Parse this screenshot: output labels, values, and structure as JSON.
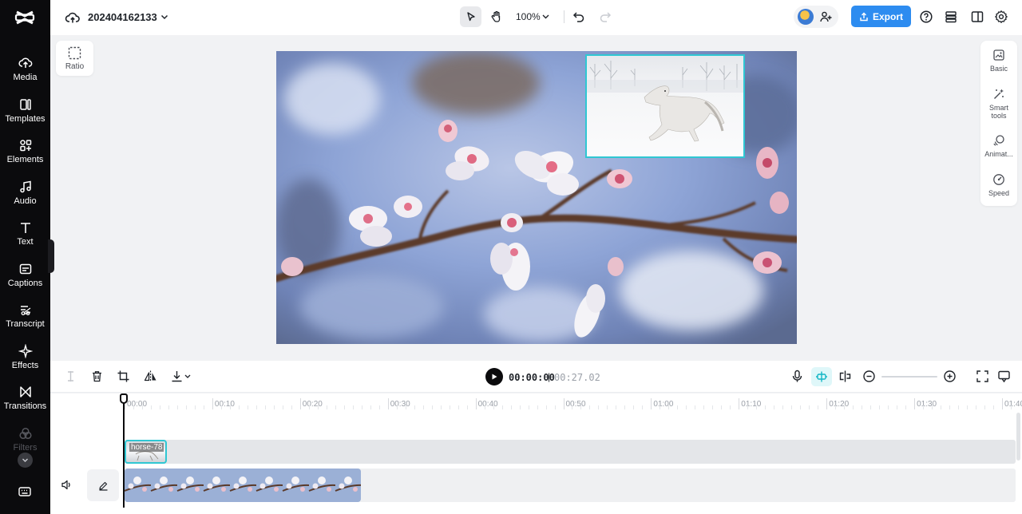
{
  "sidebar": {
    "items": [
      {
        "label": "Media",
        "icon": "cloud-upload-icon"
      },
      {
        "label": "Templates",
        "icon": "templates-icon"
      },
      {
        "label": "Elements",
        "icon": "elements-icon"
      },
      {
        "label": "Audio",
        "icon": "music-note-icon"
      },
      {
        "label": "Text",
        "icon": "text-t-icon"
      },
      {
        "label": "Captions",
        "icon": "captions-icon"
      },
      {
        "label": "Transcript",
        "icon": "transcript-icon"
      },
      {
        "label": "Effects",
        "icon": "sparkle-icon"
      },
      {
        "label": "Transitions",
        "icon": "transitions-icon"
      },
      {
        "label": "Filters",
        "icon": "filters-icon"
      }
    ]
  },
  "header": {
    "project_title": "202404162133",
    "zoom_level": "100%",
    "export_label": "Export"
  },
  "canvas": {
    "ratio_label": "Ratio"
  },
  "right_panel": {
    "items": [
      {
        "label": "Basic",
        "icon": "basic-image-icon"
      },
      {
        "label": "Smart tools",
        "icon": "magic-wand-icon"
      },
      {
        "label": "Animat...",
        "icon": "animation-icon"
      },
      {
        "label": "Speed",
        "icon": "speed-gauge-icon"
      }
    ]
  },
  "timeline": {
    "current_time": "00:00:00",
    "time_separator": "|",
    "total_time": "00:27.02",
    "ticks": [
      "00:00",
      "00:10",
      "00:20",
      "00:30",
      "00:40",
      "00:50",
      "01:00",
      "01:10",
      "01:20",
      "01:30",
      "01:40"
    ],
    "clip_overlay_label": "horse-78"
  },
  "colors": {
    "accent": "#2d8cf0",
    "selection": "#2fc7d3",
    "sidebar_bg": "#0b0b0d"
  }
}
